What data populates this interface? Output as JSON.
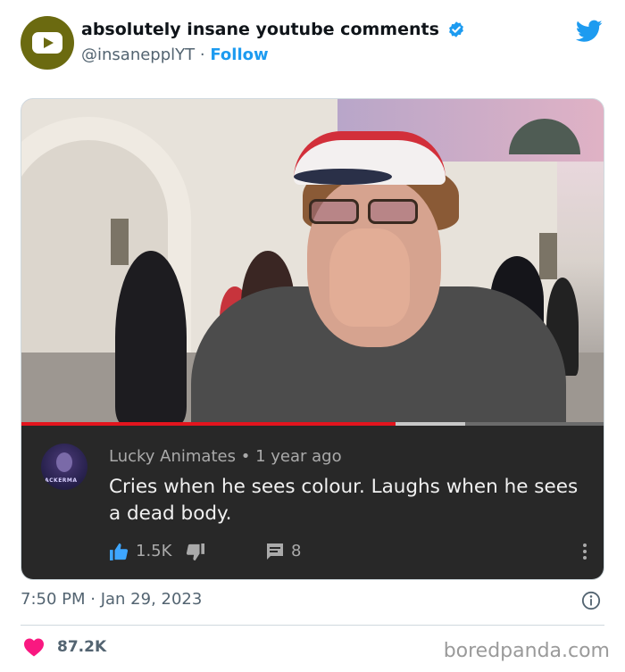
{
  "tweet": {
    "display_name": "absolutely insane youtube comments",
    "handle": "@insanepplYT",
    "separator": "·",
    "follow_label": "Follow",
    "timestamp": "7:50 PM · Jan 29, 2023",
    "likes": "87.2K"
  },
  "youtube_comment": {
    "author": "Lucky Animates",
    "meta_separator": "•",
    "age": "1 year ago",
    "text": "Cries when he sees colour. Laughs when he sees a dead body.",
    "likes": "1.5K",
    "replies": "8",
    "avatar_text": "ACKERMA",
    "progress_fraction": 0.64
  },
  "watermark": "boredpanda.com",
  "colors": {
    "twitter_blue": "#1d9bf0",
    "like_red": "#f91880",
    "yt_red": "#e3151e",
    "yt_dark": "#282828",
    "avatar_olive": "#6b6a10"
  },
  "icons": [
    "youtube-logo-icon",
    "verified-badge-icon",
    "twitter-logo-icon",
    "thumbs-up-icon",
    "thumbs-down-icon",
    "comment-icon",
    "more-icon",
    "info-icon",
    "heart-icon"
  ]
}
